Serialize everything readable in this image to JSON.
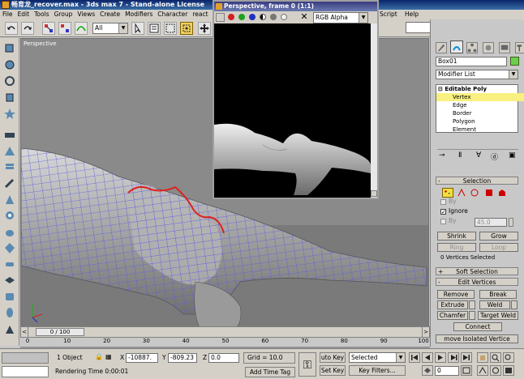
{
  "app": {
    "title": "畅育龙_recover.max - 3ds max 7 - Stand-alone License"
  },
  "menu": [
    "File",
    "Edit",
    "Tools",
    "Group",
    "Views",
    "Create",
    "Modifiers",
    "Character",
    "react",
    "Script",
    "Help"
  ],
  "toolbar": {
    "selection_filter": "All"
  },
  "viewport": {
    "label": "Perspective"
  },
  "render_window": {
    "title": "Perspective, frame 0 (1:1)",
    "channel": "RGB Alpha"
  },
  "command_panel": {
    "object_name": "Box01",
    "modifier_list": "Modifier List",
    "stack_title": "Editable Poly",
    "stack_items": [
      "Vertex",
      "Edge",
      "Border",
      "Polygon",
      "Element"
    ],
    "selected_item": "Vertex",
    "selection_rollout": "Selection",
    "by_label": "By",
    "ignore_label": "Ignore",
    "by_angle_label": "By",
    "angle_value": "45.0",
    "shrink": "Shrink",
    "grow": "Grow",
    "ring": "Ring",
    "loop": "Loop",
    "selection_status": "0 Vertices Selected",
    "soft_selection": "Soft Selection",
    "edit_vertices": "Edit Vertices",
    "remove": "Remove",
    "break": "Break",
    "extrude": "Extrude",
    "weld": "Weld",
    "chamfer": "Chamfer",
    "target_weld": "Target Weld",
    "connect": "Connect",
    "remove_isolated": "move Isolated Vertice",
    "colors": {
      "highlight": "#f8f080",
      "swatch": "#6ccf4a"
    }
  },
  "timeline": {
    "frame_label": "0 / 100",
    "ticks": [
      "0",
      "10",
      "20",
      "30",
      "40",
      "50",
      "60",
      "70",
      "80",
      "90",
      "100"
    ]
  },
  "status": {
    "selected_count": "1 Object",
    "x_label": "X",
    "x_value": "-10887.",
    "y_label": "Y",
    "y_value": "-809.23",
    "z_label": "Z",
    "z_value": "0.0",
    "grid": "Grid = 10.0",
    "auto_key": "uto Key",
    "key_mode": "Selected",
    "set_key": "Set Key",
    "key_filters": "Key Filters...",
    "frame_value": "0",
    "rendering_time": "Rendering Time  0:00:01",
    "add_time_tag": "Add Time Tag"
  }
}
